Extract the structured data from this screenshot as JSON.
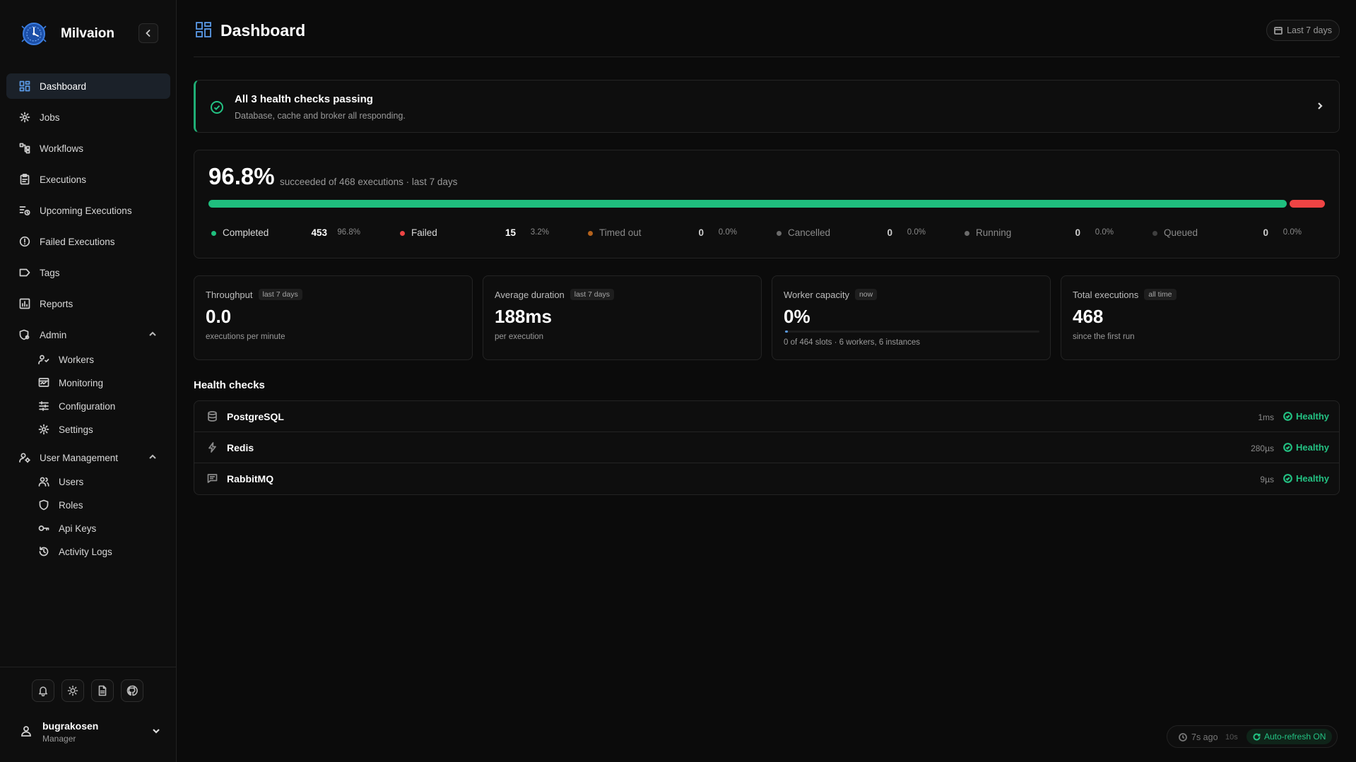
{
  "brand": {
    "name": "Milvaion"
  },
  "sidebar": {
    "items": [
      {
        "label": "Dashboard",
        "icon": "dashboard-icon"
      },
      {
        "label": "Jobs",
        "icon": "gear-icon"
      },
      {
        "label": "Workflows",
        "icon": "workflow-icon"
      },
      {
        "label": "Executions",
        "icon": "clipboard-icon"
      },
      {
        "label": "Upcoming Executions",
        "icon": "upcoming-icon"
      },
      {
        "label": "Failed Executions",
        "icon": "alert-circle-icon"
      },
      {
        "label": "Tags",
        "icon": "tag-icon"
      },
      {
        "label": "Reports",
        "icon": "bar-chart-icon"
      }
    ],
    "admin": {
      "label": "Admin",
      "items": [
        {
          "label": "Workers",
          "icon": "workers-icon"
        },
        {
          "label": "Monitoring",
          "icon": "monitor-icon"
        },
        {
          "label": "Configuration",
          "icon": "sliders-icon"
        },
        {
          "label": "Settings",
          "icon": "gear-icon"
        }
      ]
    },
    "user_management": {
      "label": "User Management",
      "items": [
        {
          "label": "Users",
          "icon": "users-icon"
        },
        {
          "label": "Roles",
          "icon": "shield-icon"
        },
        {
          "label": "Api Keys",
          "icon": "key-icon"
        },
        {
          "label": "Activity Logs",
          "icon": "history-icon"
        }
      ]
    },
    "user": {
      "name": "bugrakosen",
      "role": "Manager"
    }
  },
  "header": {
    "title": "Dashboard",
    "range": "Last 7 days"
  },
  "health_banner": {
    "title": "All 3 health checks passing",
    "subtitle": "Database, cache and broker all responding."
  },
  "summary": {
    "rate": "96.8%",
    "text": "succeeded of 468 executions · last 7 days",
    "completed_fraction": 0.968,
    "stats": [
      {
        "label": "Completed",
        "count": "453",
        "pct": "96.8%",
        "color": "#1fbf7e"
      },
      {
        "label": "Failed",
        "count": "15",
        "pct": "3.2%",
        "color": "#ef4444"
      },
      {
        "label": "Timed out",
        "count": "0",
        "pct": "0.0%",
        "color": "#b4621c"
      },
      {
        "label": "Cancelled",
        "count": "0",
        "pct": "0.0%",
        "color": "#6b6b6b"
      },
      {
        "label": "Running",
        "count": "0",
        "pct": "0.0%",
        "color": "#6b6b6b"
      },
      {
        "label": "Queued",
        "count": "0",
        "pct": "0.0%",
        "color": "#3f3f3f"
      }
    ]
  },
  "metrics": [
    {
      "title": "Throughput",
      "tag": "last 7 days",
      "value": "0.0",
      "sub": "executions per minute"
    },
    {
      "title": "Average duration",
      "tag": "last 7 days",
      "value": "188ms",
      "sub": "per execution"
    },
    {
      "title": "Worker capacity",
      "tag": "now",
      "value": "0%",
      "sub": "0 of 464 slots · 6 workers, 6 instances",
      "fill_fraction": 0.01
    },
    {
      "title": "Total executions",
      "tag": "all time",
      "value": "468",
      "sub": "since the first run"
    }
  ],
  "health_checks": {
    "title": "Health checks",
    "rows": [
      {
        "name": "PostgreSQL",
        "icon": "database-icon",
        "latency": "1ms",
        "status": "Healthy"
      },
      {
        "name": "Redis",
        "icon": "bolt-icon",
        "latency": "280µs",
        "status": "Healthy"
      },
      {
        "name": "RabbitMQ",
        "icon": "message-icon",
        "latency": "9µs",
        "status": "Healthy"
      }
    ]
  },
  "refresh": {
    "ago": "7s ago",
    "interval": "10s",
    "auto": "Auto-refresh ON"
  },
  "colors": {
    "accent": "#5b9be8",
    "success": "#23c283",
    "danger": "#ef4444"
  }
}
